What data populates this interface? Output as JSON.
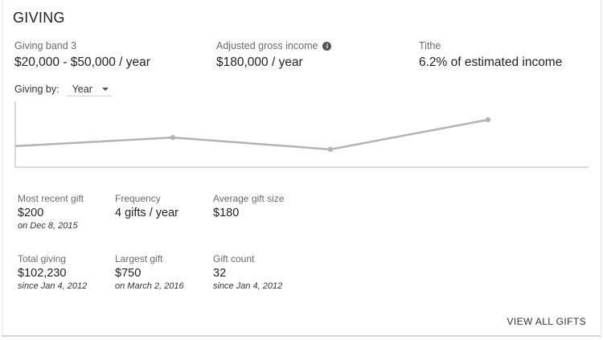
{
  "title": "GIVING",
  "summary": {
    "band_label": "Giving band 3",
    "band_value": "$20,000 - $50,000 / year",
    "agi_label": "Adjusted gross income",
    "agi_value": "$180,000 / year",
    "tithe_label": "Tithe",
    "tithe_value": "6.2% of estimated income"
  },
  "giving_by": {
    "label": "Giving by:",
    "selected": "Year"
  },
  "chart_data": {
    "type": "line",
    "points": [
      0.32,
      0.45,
      0.27,
      0.72
    ],
    "stroke": "#b3b3b3"
  },
  "stats": [
    {
      "label": "Most recent gift",
      "value": "$200",
      "sub": "on Dec 8, 2015"
    },
    {
      "label": "Frequency",
      "value": "4 gifts / year",
      "sub": ""
    },
    {
      "label": "Average gift size",
      "value": "$180",
      "sub": ""
    },
    {
      "label": "Total giving",
      "value": "$102,230",
      "sub": "since Jan 4, 2012"
    },
    {
      "label": "Largest gift",
      "value": "$750",
      "sub": "on March 2, 2016"
    },
    {
      "label": "Gift count",
      "value": "32",
      "sub": "since Jan 4, 2012"
    }
  ],
  "view_all_label": "VIEW ALL GIFTS",
  "colors": {
    "line": "#b3b3b3",
    "axis": "#cccccc",
    "text": "#222222",
    "muted": "#6b6b6b"
  },
  "icons": {
    "info": "info-icon",
    "dropdown": "chevron-down-icon"
  }
}
